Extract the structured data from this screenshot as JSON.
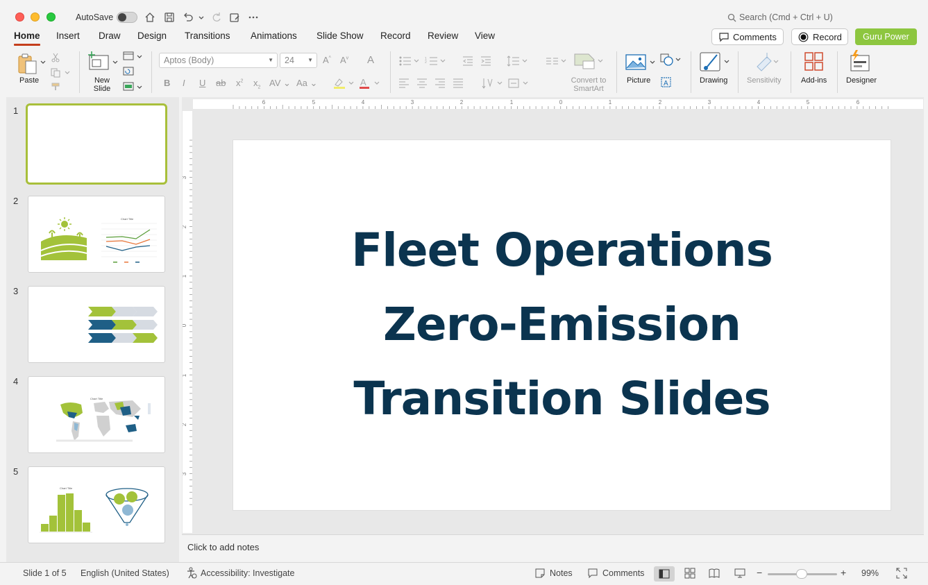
{
  "titlebar": {
    "autosave_label": "AutoSave",
    "search_placeholder": "Search (Cmd + Ctrl + U)"
  },
  "tabs": [
    "Home",
    "Insert",
    "Draw",
    "Design",
    "Transitions",
    "Animations",
    "Slide Show",
    "Record",
    "Review",
    "View"
  ],
  "actions": {
    "comments": "Comments",
    "record": "Record",
    "guru": "Guru Power"
  },
  "ribbon": {
    "paste": "Paste",
    "new_slide": "New Slide",
    "font_name": "Aptos (Body)",
    "font_size": "24",
    "convert_smartart": "Convert to SmartArt",
    "picture": "Picture",
    "drawing": "Drawing",
    "sensitivity": "Sensitivity",
    "addins": "Add-ins",
    "designer": "Designer"
  },
  "thumbnails": {
    "numbers": [
      "1",
      "2",
      "3",
      "4",
      "5"
    ],
    "chart_title": "Chart Title"
  },
  "slide": {
    "title_lines": [
      "Fleet Operations",
      "Zero-Emission",
      "Transition Slides"
    ]
  },
  "notes_placeholder": "Click to add notes",
  "status": {
    "slide_of": "Slide 1 of 5",
    "language": "English (United States)",
    "accessibility": "Accessibility: Investigate",
    "notes": "Notes",
    "comments": "Comments",
    "zoom": "99%"
  },
  "ruler": {
    "h_labels": [
      "6",
      "5",
      "4",
      "3",
      "2",
      "1",
      "0",
      "1",
      "2",
      "3",
      "4",
      "5",
      "6"
    ],
    "v_labels": [
      "3",
      "2",
      "1",
      "0",
      "1",
      "2",
      "3"
    ]
  },
  "colors": {
    "accent_green": "#8dc63f",
    "title_navy": "#0b344f",
    "tab_underline": "#c43e1c",
    "thumb_green": "#a3c23a",
    "thumb_blue": "#1f5f86"
  }
}
